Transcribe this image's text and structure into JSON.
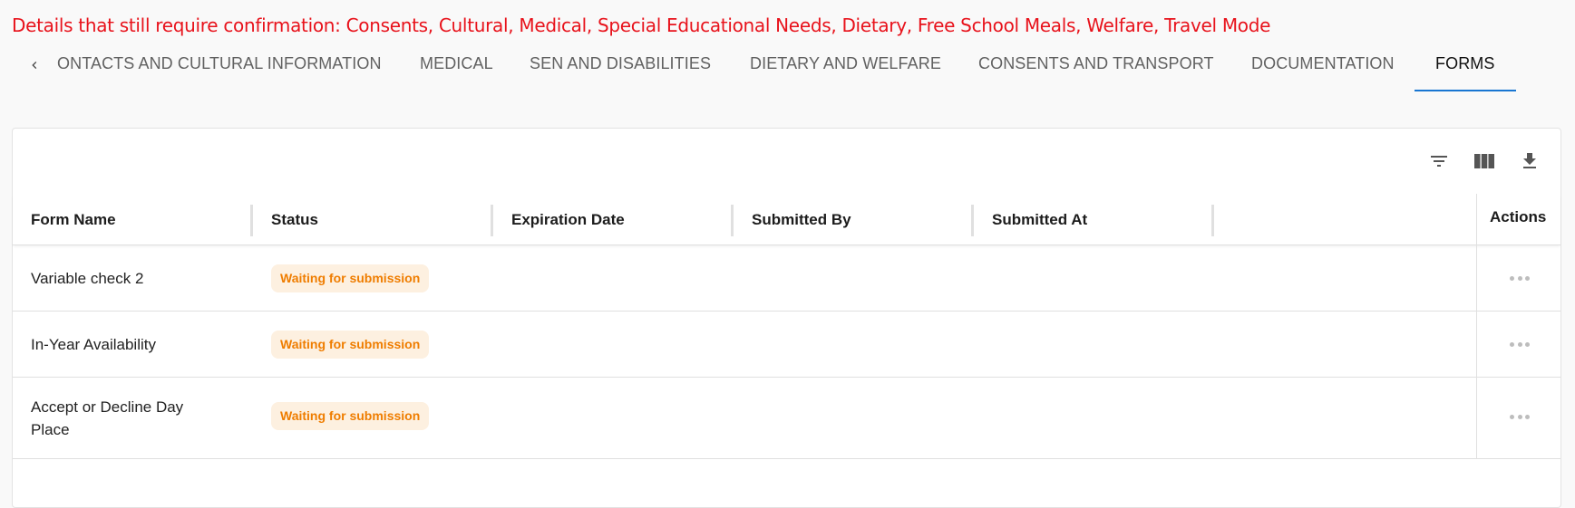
{
  "alert": {
    "text": "Details that still require confirmation: Consents, Cultural, Medical, Special Educational Needs, Dietary, Free School Meals, Welfare, Travel Mode",
    "color": "#e8121b"
  },
  "tabs": {
    "prev_icon": "chevron-left-icon",
    "items": [
      {
        "label": "ONTACTS AND CULTURAL INFORMATION"
      },
      {
        "label": "MEDICAL"
      },
      {
        "label": "SEN AND DISABILITIES"
      },
      {
        "label": "DIETARY AND WELFARE"
      },
      {
        "label": "CONSENTS AND TRANSPORT"
      },
      {
        "label": "DOCUMENTATION"
      },
      {
        "label": "FORMS"
      }
    ],
    "active": "FORMS",
    "indicator_color": "#1976d2"
  },
  "toolbar": {
    "icons": [
      "filter-icon",
      "columns-icon",
      "download-icon"
    ]
  },
  "table": {
    "columns": [
      "Form Name",
      "Status",
      "Expiration Date",
      "Submitted By",
      "Submitted At",
      "Actions"
    ],
    "rows": [
      {
        "form_name": "Variable check 2",
        "status": "Waiting for submission",
        "expiration_date": "",
        "submitted_by": "",
        "submitted_at": ""
      },
      {
        "form_name": "In-Year Availability",
        "status": "Waiting for submission",
        "expiration_date": "",
        "submitted_by": "",
        "submitted_at": ""
      },
      {
        "form_name": "Accept or Decline Day Place",
        "status": "Waiting for submission",
        "expiration_date": "",
        "submitted_by": "",
        "submitted_at": ""
      }
    ],
    "status_colors": {
      "text": "#ef7d00",
      "background": "#fdf0e0"
    }
  }
}
